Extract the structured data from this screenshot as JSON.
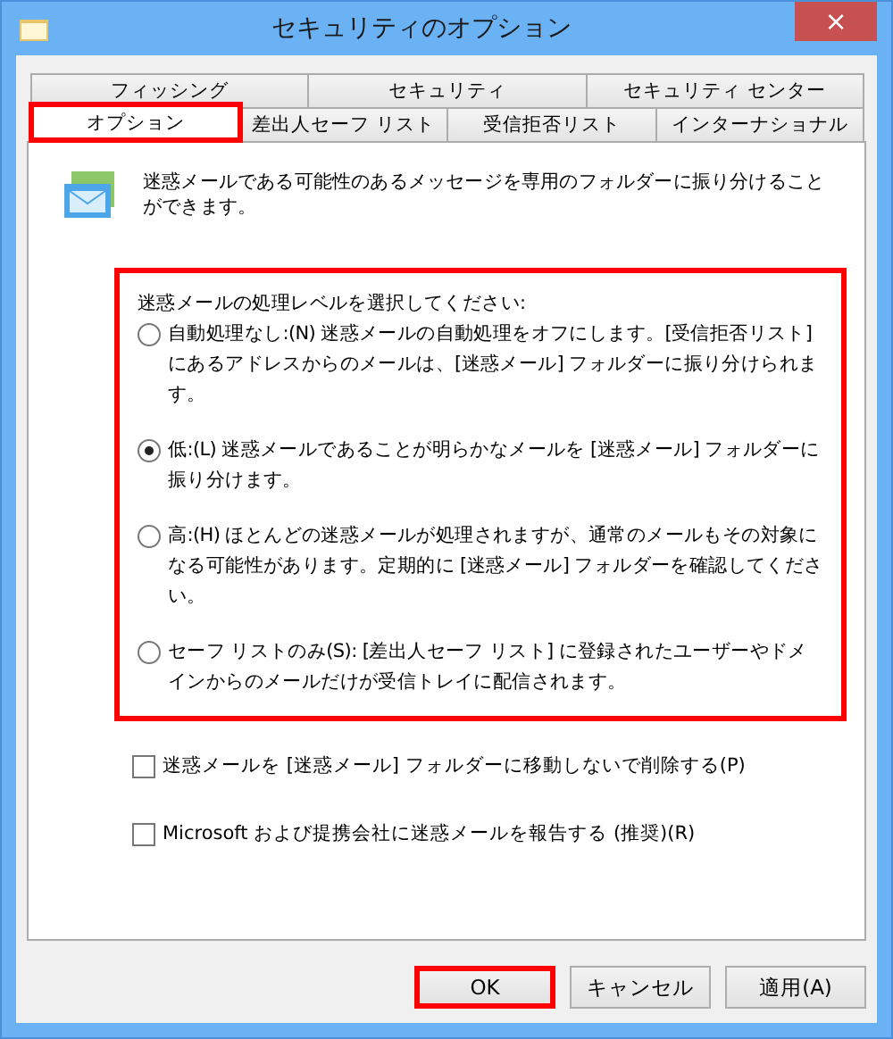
{
  "window": {
    "title": "セキュリティのオプション",
    "close": "×"
  },
  "tab_rows": [
    [
      {
        "label": "フィッシング",
        "selected": false,
        "highlighted": false
      },
      {
        "label": "セキュリティ",
        "selected": false,
        "highlighted": false
      },
      {
        "label": "セキュリティ センター",
        "selected": false,
        "highlighted": false
      }
    ],
    [
      {
        "label": "オプション",
        "selected": true,
        "highlighted": true
      },
      {
        "label": "差出人セーフ リスト",
        "selected": false,
        "highlighted": false
      },
      {
        "label": "受信拒否リスト",
        "selected": false,
        "highlighted": false
      },
      {
        "label": "インターナショナル",
        "selected": false,
        "highlighted": false
      }
    ]
  ],
  "intro": "迷惑メールである可能性のあるメッセージを専用のフォルダーに振り分けることができます。",
  "level_group": {
    "highlighted": true,
    "label": "迷惑メールの処理レベルを選択してください:",
    "options": [
      {
        "label": "自動処理なし:(N) 迷惑メールの自動処理をオフにします。[受信拒否リスト] にあるアドレスからのメールは、[迷惑メール] フォルダーに振り分けられます。",
        "selected": false
      },
      {
        "label": "低:(L) 迷惑メールであることが明らかなメールを [迷惑メール] フォルダーに振り分けます。",
        "selected": true
      },
      {
        "label": "高:(H) ほとんどの迷惑メールが処理されますが、通常のメールもその対象になる可能性があります。定期的に [迷惑メール] フォルダーを確認してください。",
        "selected": false
      },
      {
        "label": "セーフ リストのみ(S): [差出人セーフ リスト] に登録されたユーザーやドメインからのメールだけが受信トレイに配信されます。",
        "selected": false
      }
    ]
  },
  "checkboxes": [
    {
      "label": "迷惑メールを [迷惑メール] フォルダーに移動しないで削除する(P)",
      "checked": false
    },
    {
      "label": "Microsoft および提携会社に迷惑メールを報告する (推奨)(R)",
      "checked": false
    }
  ],
  "buttons": [
    {
      "label": "OK",
      "highlighted": true
    },
    {
      "label": "キャンセル",
      "highlighted": false
    },
    {
      "label": "適用(A)",
      "highlighted": false
    }
  ]
}
